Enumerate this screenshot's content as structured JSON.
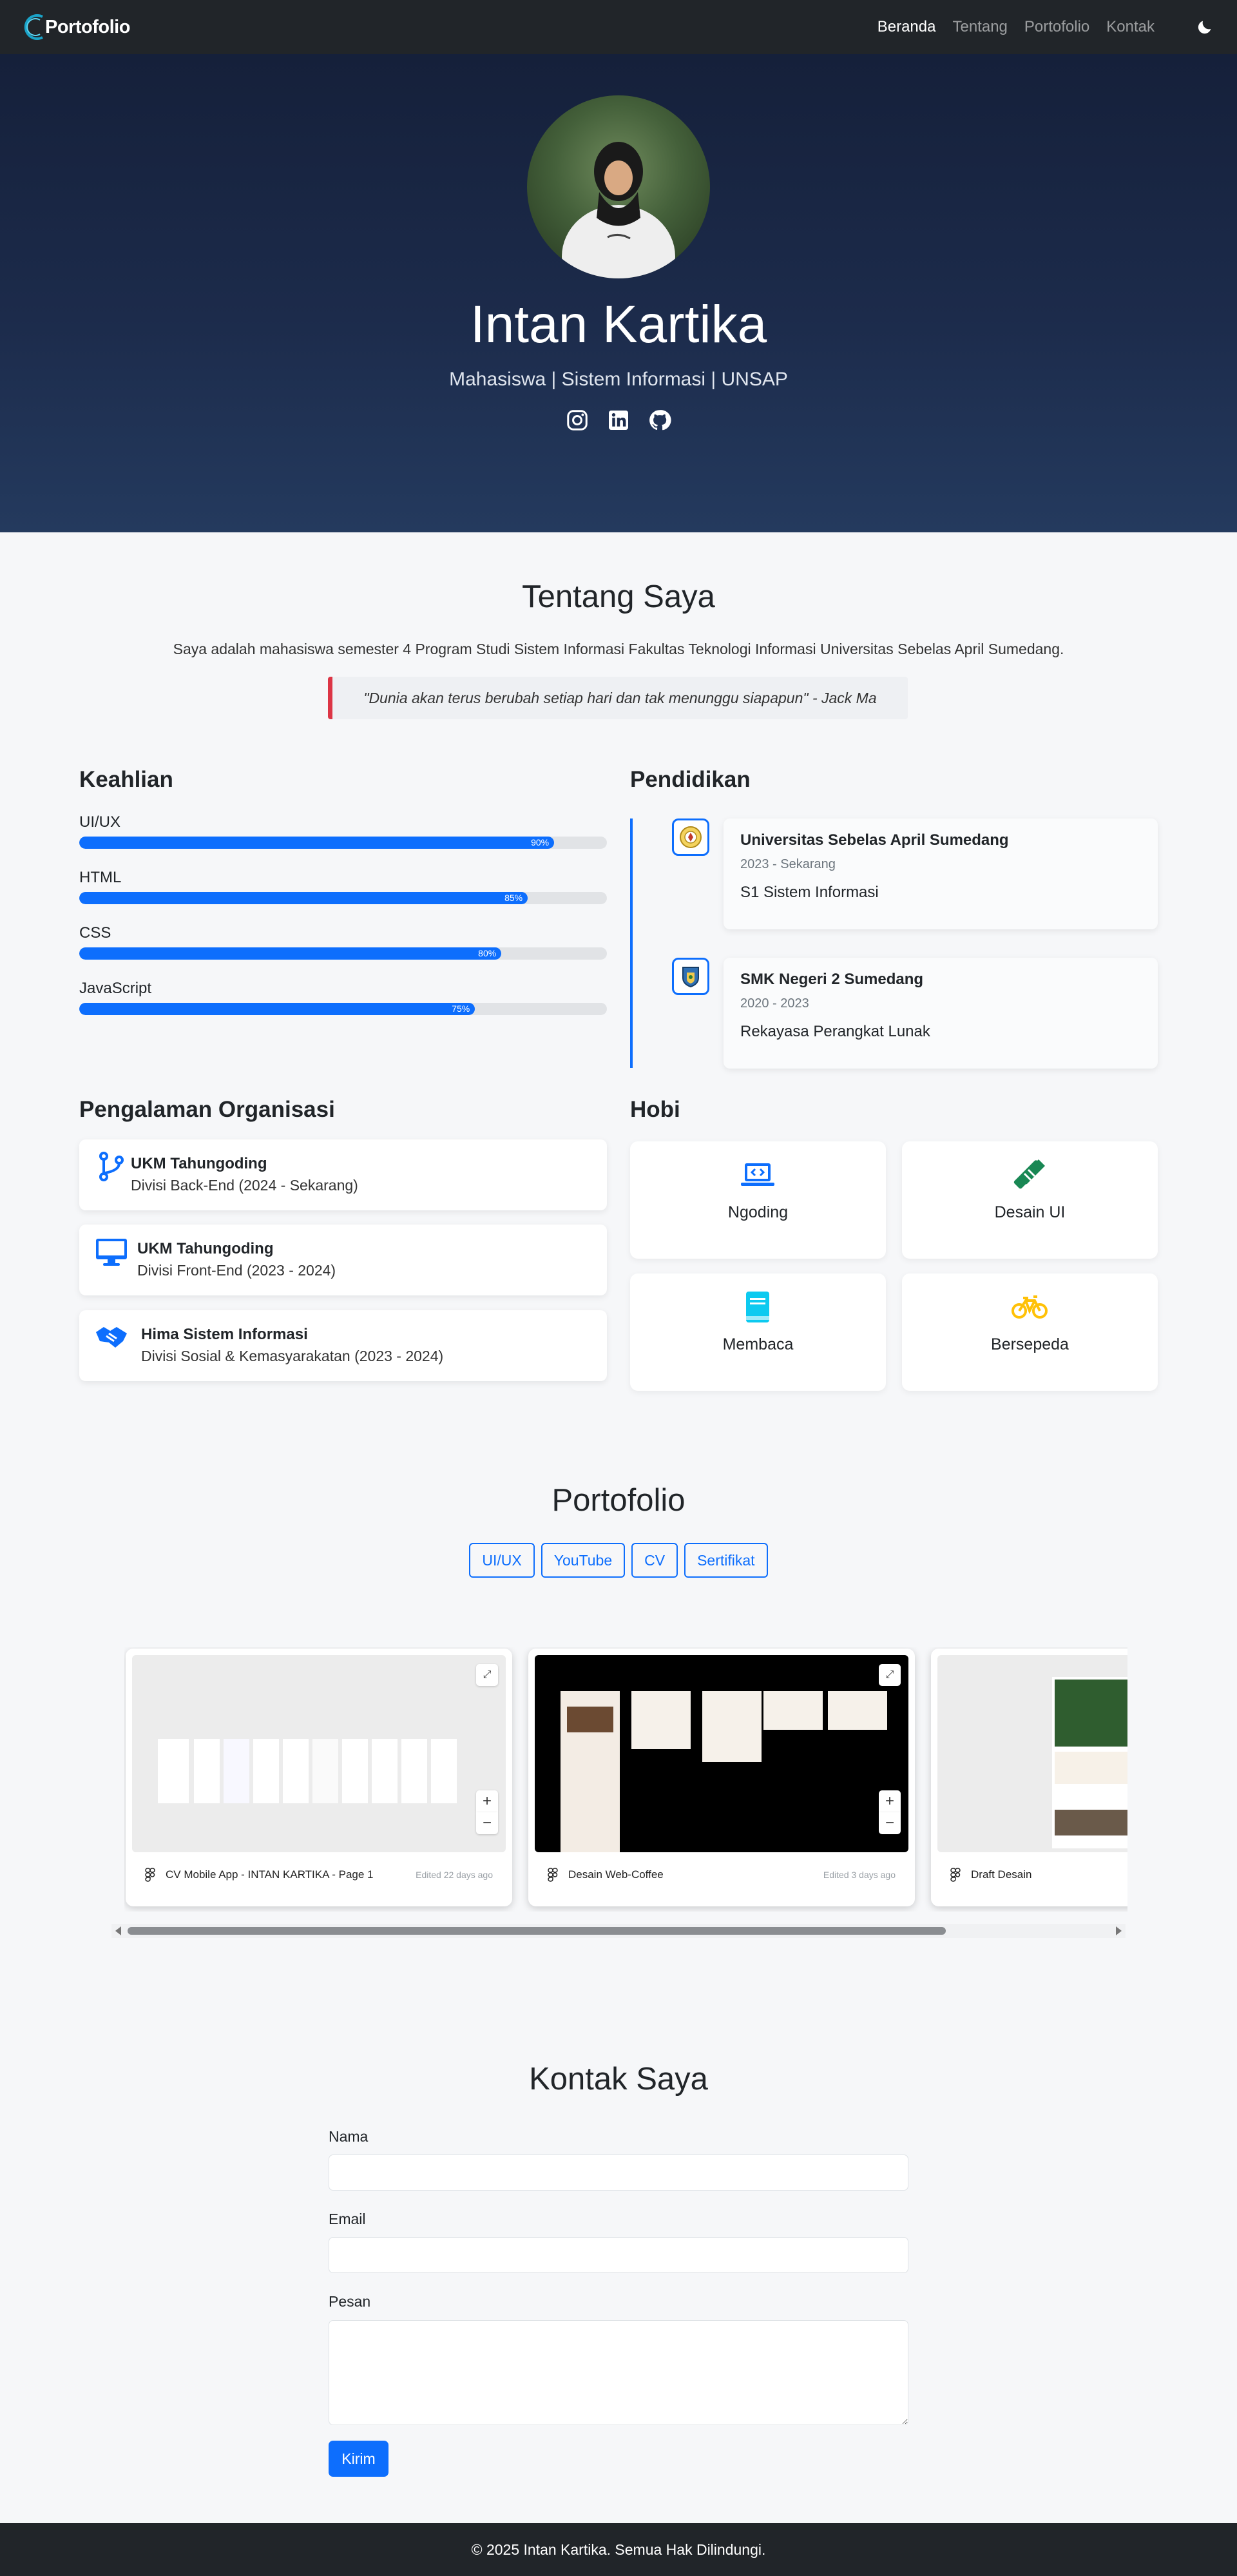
{
  "nav": {
    "brand": "Portofolio",
    "links": [
      {
        "label": "Beranda",
        "active": true
      },
      {
        "label": "Tentang",
        "active": false
      },
      {
        "label": "Portofolio",
        "active": false
      },
      {
        "label": "Kontak",
        "active": false
      }
    ],
    "theme_icon": "moon-icon"
  },
  "hero": {
    "name": "Intan Kartika",
    "subtitle": "Mahasiswa | Sistem Informasi | UNSAP",
    "social_icons": [
      "instagram-icon",
      "linkedin-icon",
      "github-icon"
    ]
  },
  "about": {
    "title": "Tentang Saya",
    "text": "Saya adalah mahasiswa semester 4 Program Studi Sistem Informasi Fakultas Teknologi Informasi Universitas Sebelas April Sumedang.",
    "quote": "\"Dunia akan terus berubah setiap hari dan tak menunggu siapapun\" - Jack Ma"
  },
  "skills": {
    "title": "Keahlian",
    "items": [
      {
        "name": "UI/UX",
        "percent": 90,
        "label": "90%"
      },
      {
        "name": "HTML",
        "percent": 85,
        "label": "85%"
      },
      {
        "name": "CSS",
        "percent": 80,
        "label": "80%"
      },
      {
        "name": "JavaScript",
        "percent": 75,
        "label": "75%"
      }
    ]
  },
  "education": {
    "title": "Pendidikan",
    "items": [
      {
        "school": "Universitas Sebelas April Sumedang",
        "years": "2023 - Sekarang",
        "major": "S1 Sistem Informasi"
      },
      {
        "school": "SMK Negeri 2 Sumedang",
        "years": "2020 - 2023",
        "major": "Rekayasa Perangkat Lunak"
      }
    ]
  },
  "organizations": {
    "title": "Pengalaman Organisasi",
    "items": [
      {
        "name": "UKM Tahungoding",
        "role": "Divisi Back-End (2024 - Sekarang)",
        "icon": "git-branch-icon"
      },
      {
        "name": "UKM Tahungoding",
        "role": "Divisi Front-End (2023 - 2024)",
        "icon": "monitor-icon"
      },
      {
        "name": "Hima Sistem Informasi",
        "role": "Divisi Sosial & Kemasyarakatan (2023 - 2024)",
        "icon": "handshake-icon"
      }
    ]
  },
  "hobbies": {
    "title": "Hobi",
    "items": [
      {
        "label": "Ngoding",
        "icon": "laptop-code-icon",
        "color": "#0d6efd"
      },
      {
        "label": "Desain UI",
        "icon": "pen-ruler-icon",
        "color": "#198754"
      },
      {
        "label": "Membaca",
        "icon": "book-icon",
        "color": "#0dcaf0"
      },
      {
        "label": "Bersepeda",
        "icon": "bicycle-icon",
        "color": "#ffc107"
      }
    ]
  },
  "portfolio": {
    "title": "Portofolio",
    "filters": [
      "UI/UX",
      "YouTube",
      "CV",
      "Sertifikat"
    ],
    "cards": [
      {
        "name": "CV Mobile App - INTAN KARTIKA - Page 1",
        "edited": "Edited 22 days ago"
      },
      {
        "name": "Desain Web-Coffee",
        "edited": "Edited 3 days ago"
      },
      {
        "name": "Draft Desain",
        "edited": ""
      }
    ]
  },
  "contact": {
    "title": "Kontak Saya",
    "name_label": "Nama",
    "email_label": "Email",
    "message_label": "Pesan",
    "submit_label": "Kirim"
  },
  "footer": {
    "text": "© 2025 Intan Kartika. Semua Hak Dilindungi."
  },
  "colors": {
    "navbar": "#212529",
    "accent": "#0d6efd",
    "quote_border": "#dc3545"
  }
}
